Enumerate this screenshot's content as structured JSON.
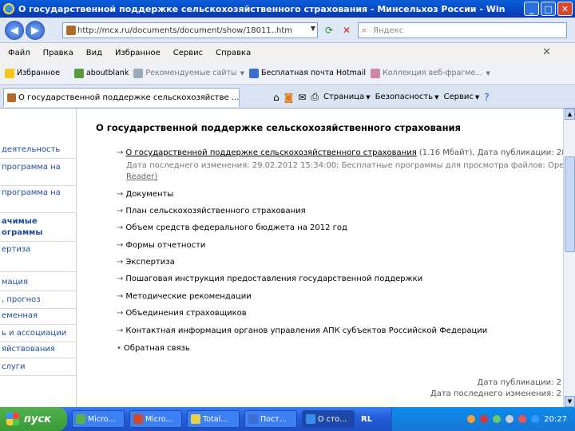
{
  "window": {
    "title": "О государственной поддержке сельскохозяйственного страхования - Минсельхоз России - Windows Internet Explorer",
    "min_label": "_",
    "max_label": "□",
    "close_label": "✕"
  },
  "address": {
    "url": "http://mcx.ru/documents/document/show/18011..htm",
    "search_placeholder": "Яндекс"
  },
  "menu": [
    "Файл",
    "Правка",
    "Вид",
    "Избранное",
    "Сервис",
    "Справка"
  ],
  "favorites": {
    "label": "Избранное",
    "items": [
      "aboutblank",
      "Рекомендуемые сайты",
      "Бесплатная почта Hotmail",
      "Коллекция веб-фрагме..."
    ]
  },
  "tab": {
    "label": "О государственной поддержке сельскохозяйстве ..."
  },
  "toolbar": {
    "page": "Страница",
    "security": "Безопасность",
    "service": "Сервис"
  },
  "leftnav": [
    {
      "label": "деятельность",
      "bold": false
    },
    {
      "label": "программа на",
      "bold": false
    },
    {
      "label": "программа на",
      "bold": false
    },
    {
      "label": "ачимые",
      "bold": true
    },
    {
      "label": "ограммы",
      "bold": true
    },
    {
      "label": "ертиза",
      "bold": false
    },
    {
      "label": "мация",
      "bold": false
    },
    {
      "label": ", прогноз",
      "bold": false
    },
    {
      "label": "еменная",
      "bold": false
    },
    {
      "label": "ь и ассоциации",
      "bold": false
    },
    {
      "label": "яйствования",
      "bold": false
    },
    {
      "label": "слуги",
      "bold": false
    }
  ],
  "content": {
    "heading": "О государственной поддержке сельскохозяйственного страхования",
    "first_item": "О государственной поддержке сельскохозяйственного страхования",
    "first_item_meta": " (1.16 Мбайт), Дата публикации: 28",
    "changed": "Дата последнего изменения: 29.02.2012 15:34:00; Бесплатные программы для просмотра файлов: OpenO",
    "reader": "Reader)",
    "items": [
      "Документы",
      "План сельскохозяйственного страхования",
      "Объем средств федерального бюджета на 2012 год",
      "Формы отчетности",
      "Экспертиза",
      "Пошаговая инструкция предоставления государственной поддержки",
      "Методические рекомендации",
      "Объединения страховщиков",
      "Контактная информация органов управления АПК субъектов Российской Федерации",
      "Обратная связь"
    ],
    "pub_date": "Дата публикации: 2",
    "changed_footer": "Дата последнего изменения: 2"
  },
  "taskbar": {
    "start": "пуск",
    "items": [
      "Micro...",
      "Micro...",
      "Total...",
      "Пост...",
      "О сто..."
    ],
    "lang": "RL",
    "clock": "20:27"
  }
}
